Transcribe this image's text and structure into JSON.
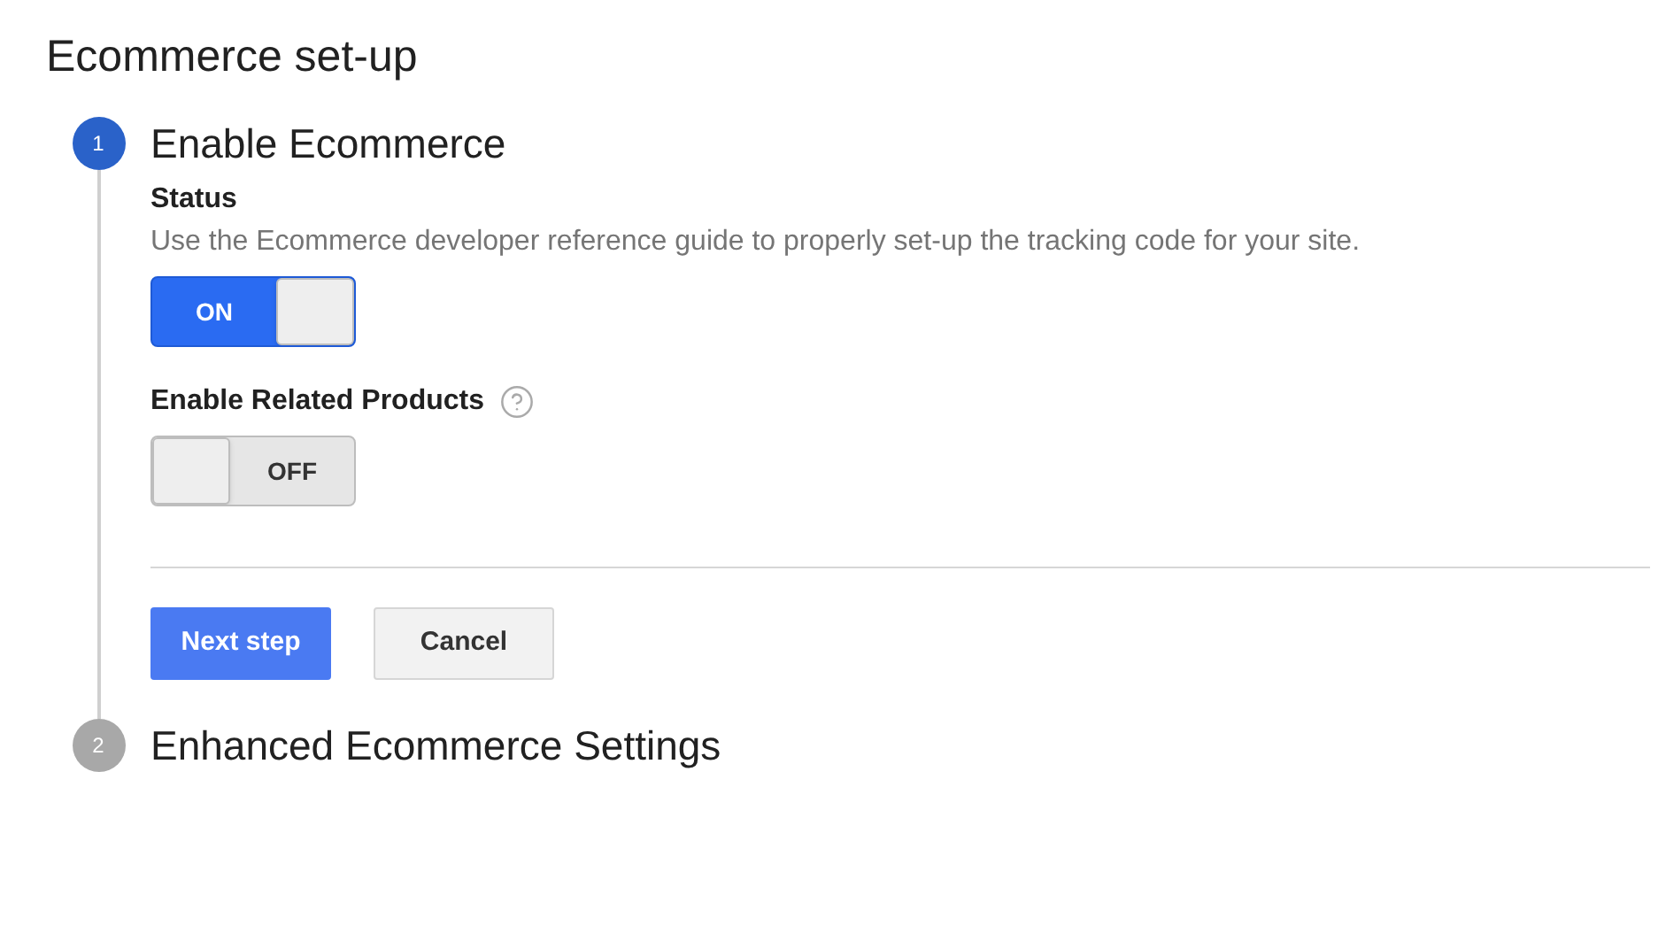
{
  "title": "Ecommerce set-up",
  "steps": [
    {
      "number": "1",
      "title": "Enable Ecommerce",
      "selected": true,
      "settings": [
        {
          "label": "Status",
          "help": false,
          "description": "Use the Ecommerce developer reference guide to properly set-up the tracking code for your site.",
          "toggle": {
            "on": true,
            "text": "ON"
          }
        },
        {
          "label": "Enable Related Products",
          "help": true,
          "toggle": {
            "on": false,
            "text": "OFF"
          }
        }
      ],
      "buttons": [
        {
          "label": "Next step",
          "kind": "primary"
        },
        {
          "label": "Cancel",
          "kind": "secondary"
        }
      ]
    },
    {
      "number": "2",
      "title": "Enhanced Ecommerce Settings",
      "selected": false
    }
  ]
}
